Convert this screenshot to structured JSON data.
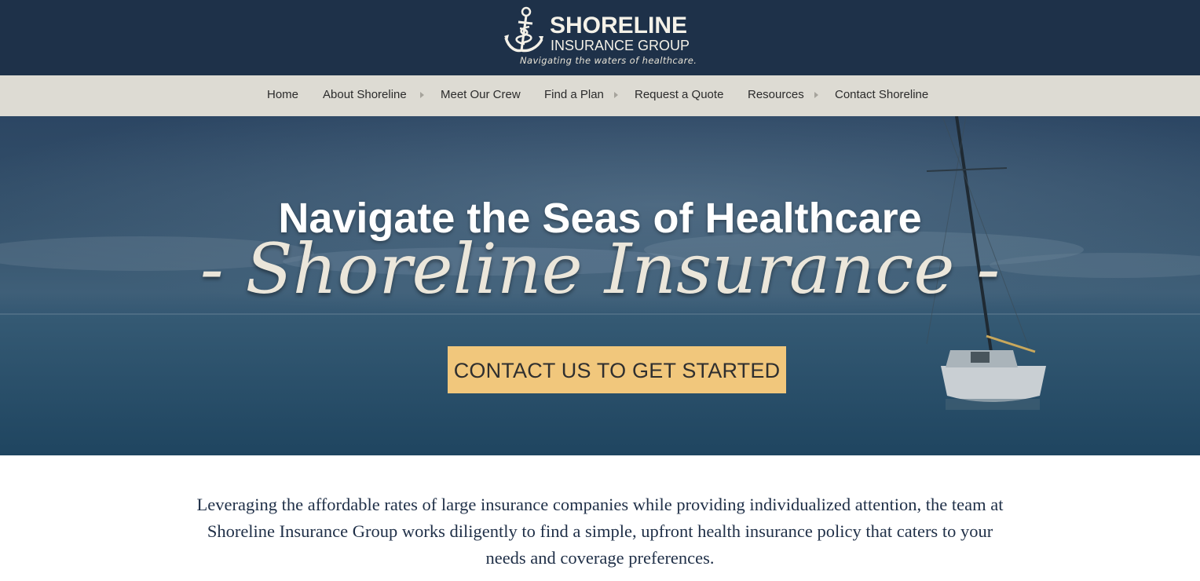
{
  "header": {
    "logo_name": "SHORELINE",
    "logo_sub": "INSURANCE GROUP",
    "tagline": "Navigating the waters of healthcare.",
    "logo_icon": "anchor-caduceus-icon"
  },
  "nav": {
    "items": [
      {
        "label": "Home",
        "has_submenu": false
      },
      {
        "label": "About Shoreline",
        "has_submenu": true
      },
      {
        "label": "Meet Our Crew",
        "has_submenu": false
      },
      {
        "label": "Find a Plan",
        "has_submenu": true
      },
      {
        "label": "Request a Quote",
        "has_submenu": false
      },
      {
        "label": "Resources",
        "has_submenu": true
      },
      {
        "label": "Contact Shoreline",
        "has_submenu": false
      }
    ]
  },
  "hero": {
    "title": "Navigate the Seas of Healthcare",
    "script": "- Shoreline Insurance -",
    "cta_label": "CONTACT US TO GET STARTED",
    "cta_color": "#f1c77c"
  },
  "intro": {
    "text": "Leveraging the affordable rates of large insurance companies while providing individualized attention, the team at Shoreline Insurance Group works diligently to find a simple, upfront health insurance policy that caters to your needs and coverage preferences."
  },
  "colors": {
    "header_bg": "#1e3149",
    "nav_bg": "#dddbd3",
    "intro_text": "#1f2f47"
  }
}
